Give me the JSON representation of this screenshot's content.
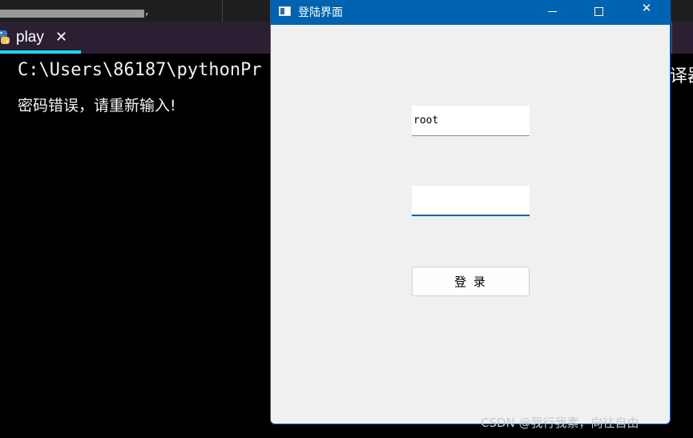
{
  "ide": {
    "crumb_fragment": "",
    "comma": ",",
    "tab": {
      "label": "play",
      "close_symbol": "✕",
      "icon": "python-icon"
    }
  },
  "terminal": {
    "line1": "C:\\Users\\86187\\pythonPr",
    "line2": "密码错误，请重新输入!",
    "right_fragment": "译器"
  },
  "login_window": {
    "title": "登陆界面",
    "controls": {
      "minimize": "minimize-icon",
      "maximize": "maximize-icon",
      "close": "✕"
    },
    "username": {
      "value": "root"
    },
    "password": {
      "value": ""
    },
    "login_button": "登  录"
  },
  "watermark": "CSDN @我行我素，向往自由",
  "colors": {
    "accent": "#0063b1",
    "tab_underline": "#20d3ee",
    "window_bg": "#f0f0f0"
  }
}
